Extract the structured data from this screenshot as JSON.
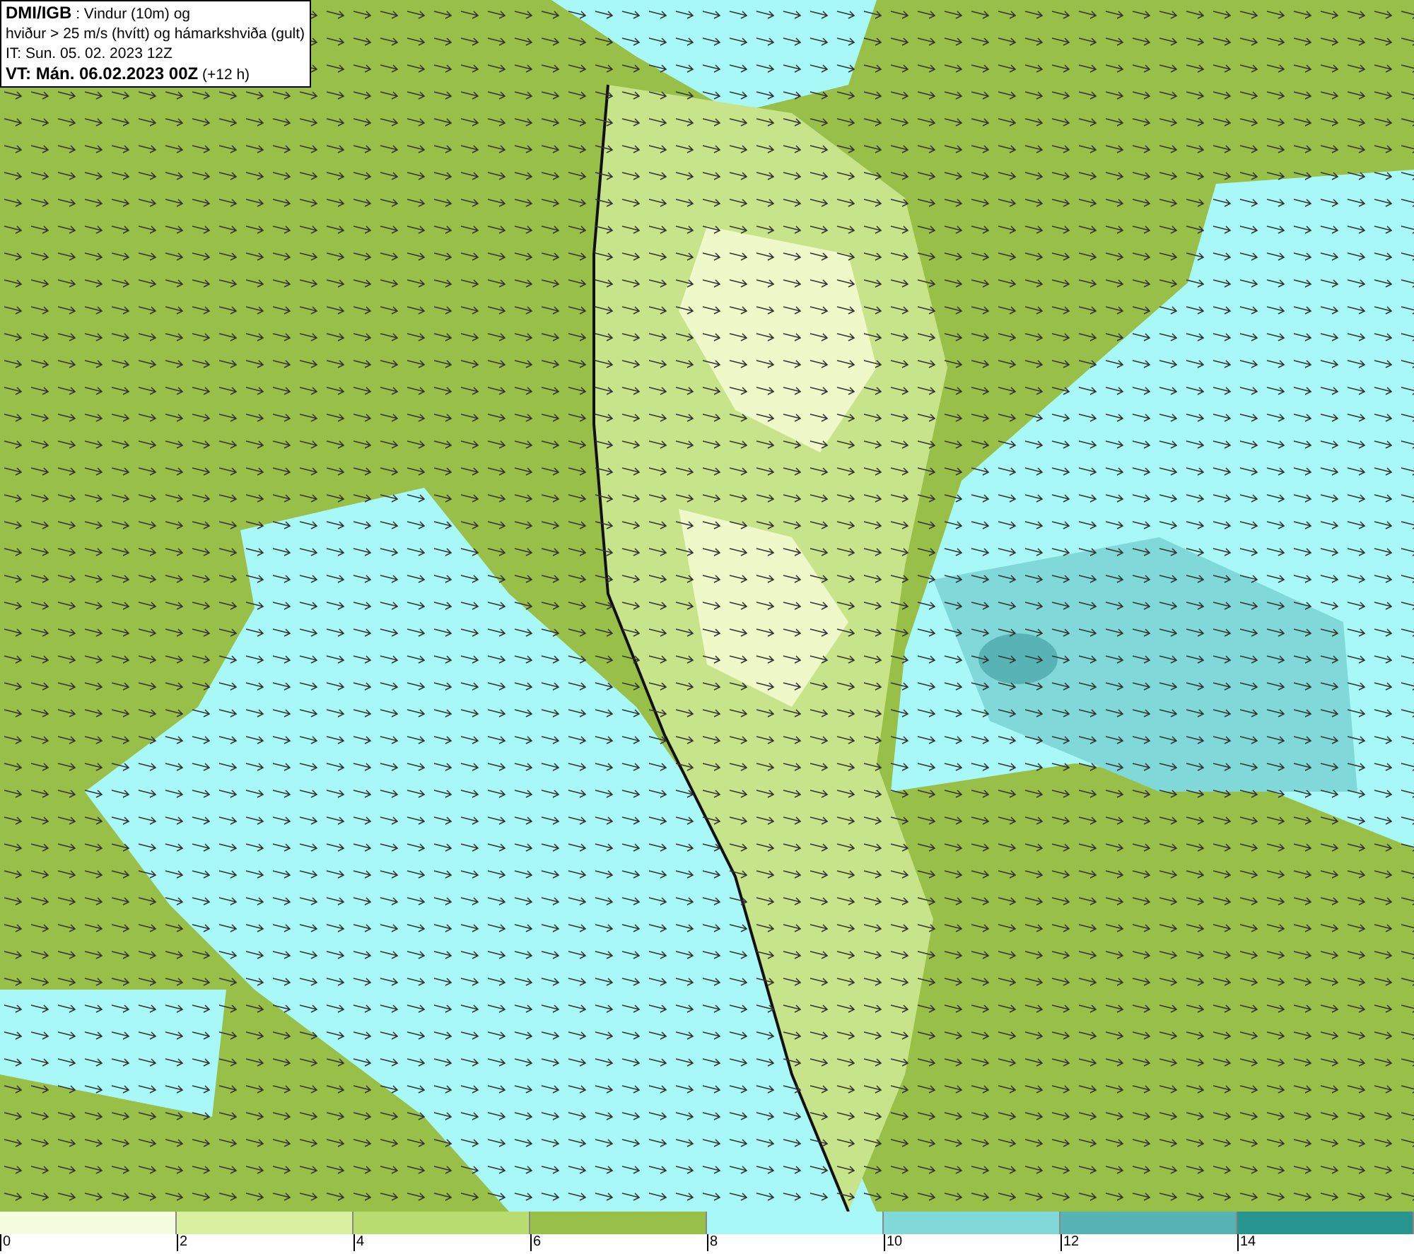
{
  "info_box": {
    "lines": [
      "**DMI/IGB** : Vindur (10m) og",
      "hviður > 25 m/s (hvítt) og hámarkshviða (gult)",
      "IT: Sun. 05. 02. 2023 12Z",
      "**VT: Mán. 06.02.2023 00Z** (+12 h)"
    ]
  },
  "legend": {
    "bins": [
      {
        "color": "#f5fde0"
      },
      {
        "color": "#d8f0a0"
      },
      {
        "color": "#b8dc70"
      },
      {
        "color": "#98c048"
      },
      {
        "color": "#a8f8f8"
      },
      {
        "color": "#80d8d8"
      },
      {
        "color": "#58b4b4"
      },
      {
        "color": "#289490"
      }
    ],
    "ticks": [
      "0",
      "2",
      "4",
      "6",
      "8",
      "10",
      "12",
      "14"
    ]
  }
}
